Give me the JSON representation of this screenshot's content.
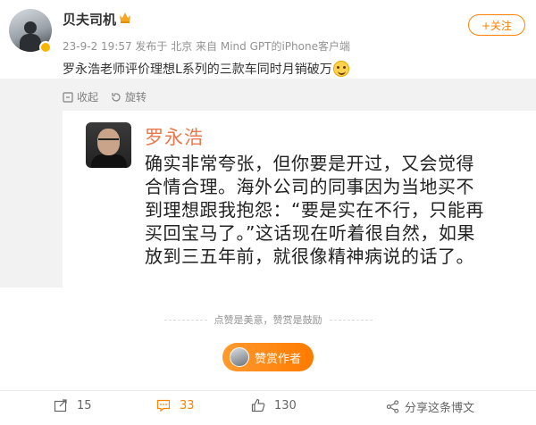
{
  "author": {
    "name": "贝夫司机",
    "meta": "23-9-2 19:57  发布于 北京  来自 Mind GPT的iPhone客户端"
  },
  "follow_label": "+关注",
  "post_text": "罗永浩老师评价理想L系列的三款车同时月销破万",
  "repost_toolbar": {
    "collapse": "收起",
    "rotate": "旋转"
  },
  "quote": {
    "name": "罗永浩",
    "lines": [
      "确实非常夸张，但你要是开过，又会觉得",
      "合情合理。海外公司的同事因为当地买不",
      "到理想跟我抱怨：“要是实在不行，只能再",
      "买回宝马了。”这话现在听着很自然，如果",
      "放到三五年前，就很像精神病说的话了。"
    ]
  },
  "tip_text": "点赞是美意，赞赏是鼓励",
  "reward_label": "赞赏作者",
  "actions": {
    "reposts": "15",
    "comments": "33",
    "likes": "130",
    "share": "分享这条博文"
  },
  "colors": {
    "accent": "#ff8200",
    "quote_name": "#e8794f"
  }
}
